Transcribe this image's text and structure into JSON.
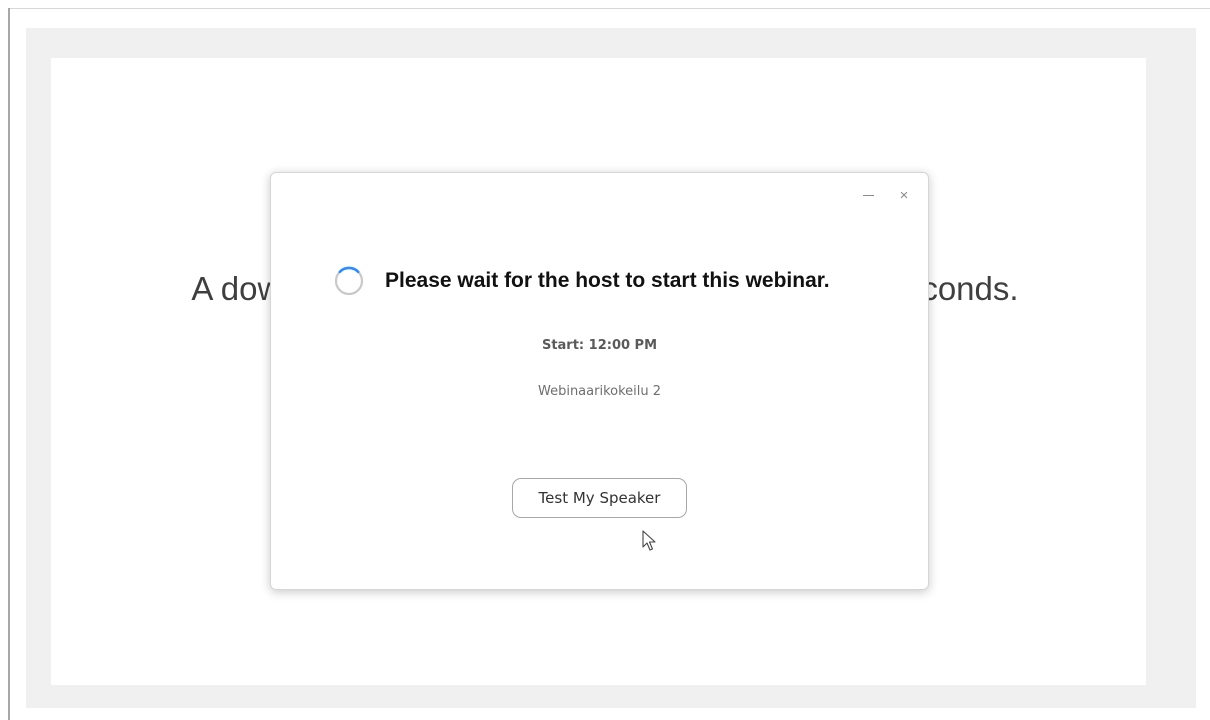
{
  "background": {
    "message_left": "A dow",
    "message_right": "conds."
  },
  "dialog": {
    "window_controls": {
      "minimize_icon": "minimize-icon",
      "close_icon": "close-icon",
      "close_glyph": "×"
    },
    "status": {
      "icon": "loading-spinner-icon",
      "title": "Please wait for the host to start this webinar."
    },
    "start_time": "Start: 12:00 PM",
    "webinar_name": "Webinaarikokeilu 2",
    "test_speaker_label": "Test My Speaker"
  },
  "pointer": {
    "icon": "mouse-pointer-icon"
  },
  "colors": {
    "spinner_accent": "#2d8cff",
    "spinner_track": "#c9c9c9",
    "frame_gray": "#f0f0f0"
  }
}
